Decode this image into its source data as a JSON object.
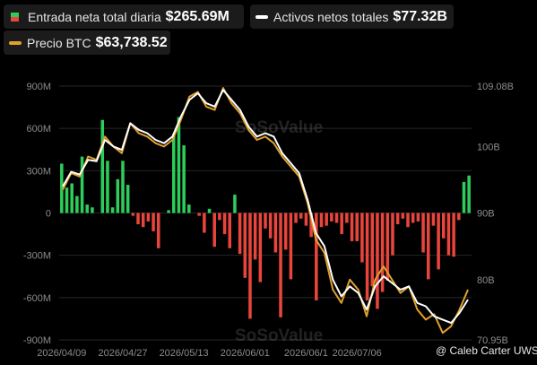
{
  "legend": {
    "flow": {
      "label": "Entrada neta total diaria",
      "value": "$265.69M"
    },
    "assets": {
      "label": "Activos netos totales",
      "value": "$77.32B"
    },
    "price": {
      "label": "Precio BTC",
      "value": "$63,738.52"
    }
  },
  "watermark": "SoSoValue",
  "credit": "@ Caleb Carter UWSE",
  "colors": {
    "background": "#000000",
    "inflow": "#2ecc5a",
    "outflow": "#e8453c",
    "assets_line": "#ffffff",
    "price_line": "#e0a12a",
    "grid": "#262626"
  },
  "chart_data": {
    "type": "bar",
    "left_axis": {
      "ticks": [
        "900M",
        "600M",
        "300M",
        "0",
        "-300M",
        "-600M",
        "-900M"
      ],
      "range": [
        -900,
        900
      ],
      "unit": "M"
    },
    "right_axis": {
      "ticks": [
        "109.08B",
        "100B",
        "90B",
        "80B",
        "70.95B"
      ],
      "range": [
        70.95,
        109.08
      ],
      "unit": "B"
    },
    "x_ticks": [
      {
        "label": "2026/04/09",
        "index": 0
      },
      {
        "label": "2026/04/27",
        "index": 12
      },
      {
        "label": "2026/05/13",
        "index": 24
      },
      {
        "label": "2026/06/01",
        "index": 36
      },
      {
        "label": "2026/06/1",
        "index": 48
      },
      {
        "label": "2026/07/06",
        "index": 58
      }
    ],
    "series": [
      {
        "name": "Entrada neta total diaria",
        "kind": "bar",
        "values": [
          350,
          180,
          210,
          120,
          400,
          60,
          40,
          0,
          660,
          370,
          40,
          240,
          370,
          200,
          -20,
          -80,
          -100,
          -60,
          -130,
          -250,
          0,
          20,
          560,
          680,
          480,
          60,
          0,
          -20,
          -140,
          30,
          -240,
          -50,
          -150,
          -250,
          130,
          -290,
          -460,
          -750,
          -330,
          -490,
          -110,
          -180,
          -280,
          -740,
          -260,
          -470,
          -70,
          -40,
          -90,
          -170,
          -620,
          -100,
          -90,
          -60,
          -70,
          -150,
          -70,
          -200,
          -200,
          -350,
          -620,
          -520,
          -680,
          -560,
          -480,
          -300,
          -80,
          -40,
          -100,
          -70,
          -60,
          -280,
          -470,
          -90,
          -400,
          -180,
          -300,
          -310,
          -50,
          220,
          265.69
        ]
      },
      {
        "name": "Activos netos totales",
        "kind": "line",
        "values": [
          94.0,
          96.2,
          95.8,
          98.0,
          97.8,
          101.0,
          100.0,
          99.5,
          103.5,
          102.5,
          102.0,
          101.0,
          100.5,
          101.5,
          104.5,
          107.0,
          108.0,
          106.5,
          106.0,
          108.5,
          107.0,
          105.5,
          103.0,
          101.5,
          102.0,
          101.5,
          99.0,
          97.5,
          96.0,
          92.0,
          87.0,
          85.0,
          80.0,
          77.5,
          79.0,
          78.0,
          75.5,
          79.0,
          80.5,
          79.5,
          78.5,
          79.0,
          76.5,
          76.0,
          74.5,
          74.0,
          73.5,
          75.0,
          77.0
        ]
      },
      {
        "name": "Precio BTC",
        "kind": "line",
        "values": [
          93.5,
          96.0,
          95.5,
          98.5,
          98.0,
          101.5,
          100.0,
          99.0,
          103.5,
          102.0,
          101.5,
          100.5,
          100.0,
          101.0,
          104.0,
          107.5,
          108.2,
          106.0,
          105.5,
          108.8,
          106.5,
          105.0,
          102.5,
          101.0,
          101.5,
          100.5,
          98.5,
          97.0,
          95.5,
          91.5,
          86.0,
          84.0,
          78.5,
          76.5,
          80.0,
          78.5,
          74.5,
          80.0,
          82.0,
          80.0,
          78.0,
          79.0,
          75.5,
          74.0,
          74.8,
          72.0,
          73.0,
          75.5,
          78.5
        ]
      }
    ],
    "grid": true,
    "legend_position": "top-left"
  }
}
